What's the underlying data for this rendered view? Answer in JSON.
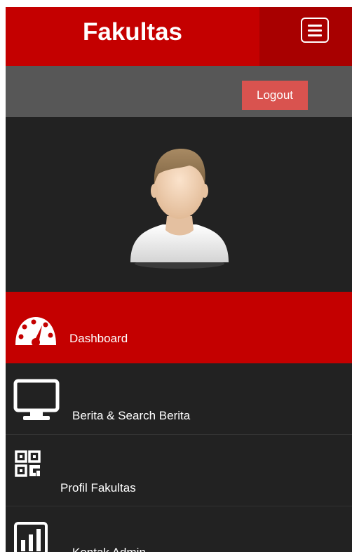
{
  "header": {
    "title": "Fakultas",
    "menu_toggle_icon": "hamburger-menu-icon"
  },
  "user_bar": {
    "logout_label": "Logout"
  },
  "profile": {
    "avatar_icon": "user-avatar-icon"
  },
  "menu": {
    "items": [
      {
        "label": "Dashboard",
        "icon": "speedometer-icon",
        "active": true
      },
      {
        "label": "Berita & Search Berita",
        "icon": "monitor-icon",
        "active": false
      },
      {
        "label": "Profil Fakultas",
        "icon": "qr-code-icon",
        "active": false
      },
      {
        "label": "Kontak Admin",
        "icon": "bar-chart-icon",
        "active": false
      }
    ]
  },
  "colors": {
    "primary_red": "#c40000",
    "toggle_red": "#a80000",
    "logout_red": "#d9534f",
    "dark_bg": "#222222",
    "user_bar_gray": "#575757"
  }
}
